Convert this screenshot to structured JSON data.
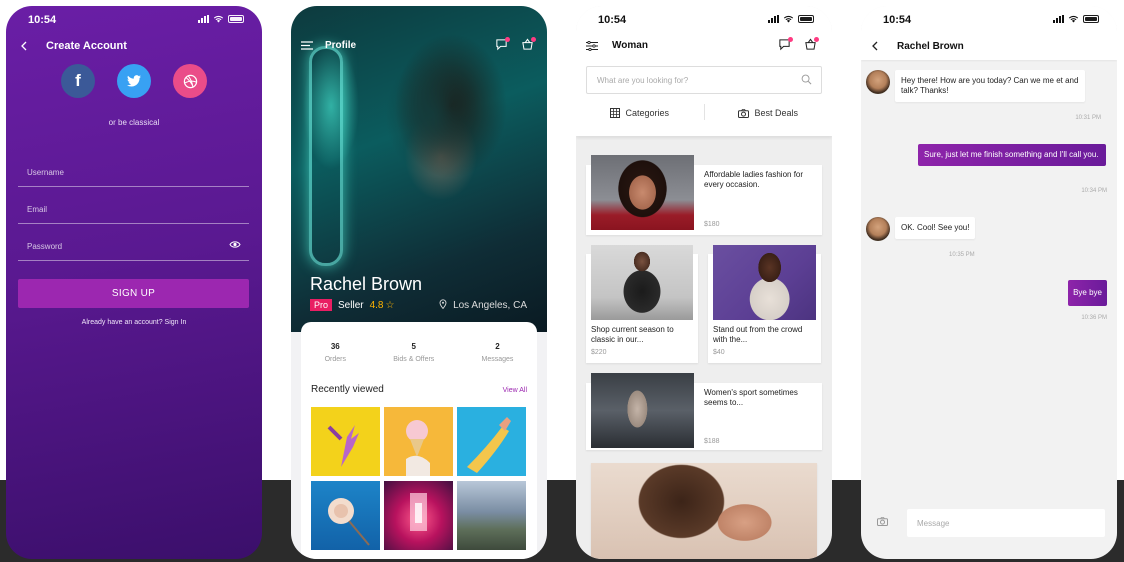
{
  "status_bar": {
    "time": "10:54"
  },
  "screen1": {
    "title": "Create Account",
    "social_icons": [
      "facebook-icon",
      "twitter-icon",
      "dribbble-icon"
    ],
    "divider_text": "or be classical",
    "fields": {
      "username": "Username",
      "email": "Email",
      "password": "Password"
    },
    "signup_label": "SIGN UP",
    "signin_text": "Already have an account? Sign In",
    "accent": "#9c27b0"
  },
  "screen2": {
    "title": "Profile",
    "name": "Rachel Brown",
    "badge": "Pro",
    "role": "Seller",
    "rating": "4.8",
    "location": "Los Angeles, CA",
    "stats": [
      {
        "value": "36",
        "label": "Orders"
      },
      {
        "value": "5",
        "label": "Bids & Offers"
      },
      {
        "value": "2",
        "label": "Messages"
      }
    ],
    "recent_title": "Recently viewed",
    "view_all": "View All"
  },
  "screen3": {
    "title": "Woman",
    "search_placeholder": "What are you looking for?",
    "tabs": [
      "Categories",
      "Best Deals"
    ],
    "products": [
      {
        "title": "Affordable ladies fashion for every occasion.",
        "price": "$180"
      },
      {
        "title": "Shop current season to classic in our...",
        "price": "$220"
      },
      {
        "title": "Stand out from the crowd with the...",
        "price": "$40"
      },
      {
        "title": "Women's sport sometimes seems to...",
        "price": "$188"
      }
    ]
  },
  "screen4": {
    "title": "Rachel Brown",
    "messages": [
      {
        "from": "them",
        "text": "Hey there! How are you today? Can we me et and talk? Thanks!",
        "time": "10:31 PM"
      },
      {
        "from": "me",
        "text": "Sure, just let me finish something and I'll call you.",
        "time": "10:34 PM"
      },
      {
        "from": "them",
        "text": "OK. Cool! See you!",
        "time": "10:35 PM"
      },
      {
        "from": "me",
        "text": "Bye bye",
        "time": "10:36 PM"
      }
    ],
    "input_placeholder": "Message"
  }
}
